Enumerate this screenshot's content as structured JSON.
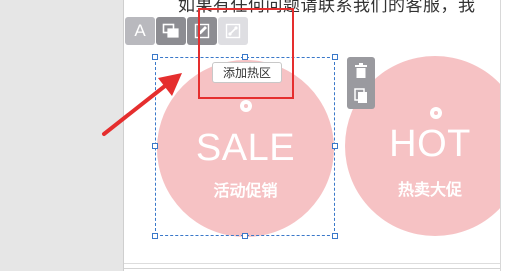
{
  "page": {
    "intro_text": "如果有任何问题请联系我们的客服，我"
  },
  "toolbar": {
    "text_btn_icon": "text-icon",
    "text_btn_glyph": "A",
    "copy_btn_icon": "copy-layers-icon",
    "edit_btn_icon": "edit-pencil-icon",
    "link_btn_icon": "link-icon"
  },
  "hotspot": {
    "add_label": "添加热区"
  },
  "side_actions": {
    "delete_icon": "trash-icon",
    "copy_icon": "duplicate-icon"
  },
  "circles": [
    {
      "title": "SALE",
      "subtitle": "活动促销"
    },
    {
      "title": "HOT",
      "subtitle": "热卖大促"
    }
  ],
  "colors": {
    "circle_fill": "#f6c2c4",
    "selection": "#3a78c9",
    "annotation_red": "#e52e2e"
  }
}
